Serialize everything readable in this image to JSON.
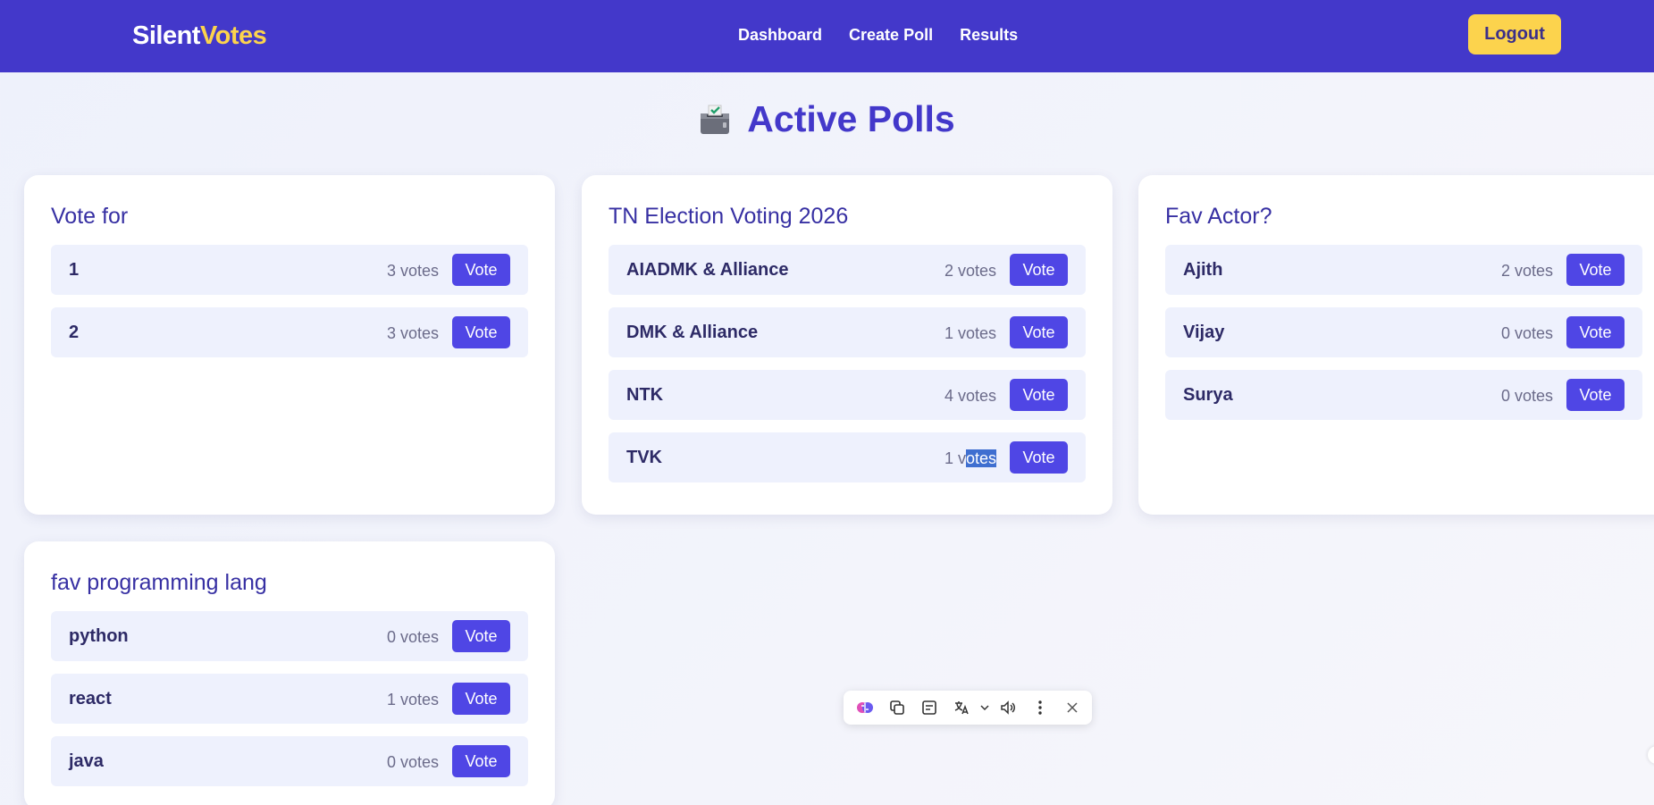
{
  "brand": {
    "part1": "Silent",
    "part2": "Votes"
  },
  "nav": {
    "links": [
      "Dashboard",
      "Create Poll",
      "Results"
    ],
    "logout_label": "Logout"
  },
  "page": {
    "title": "Active Polls",
    "title_icon": "ballot-box-icon"
  },
  "vote_label": "Vote",
  "polls": [
    {
      "title": "Vote for",
      "options": [
        {
          "label": "1",
          "count": "3 votes"
        },
        {
          "label": "2",
          "count": "3 votes"
        }
      ]
    },
    {
      "title": "TN Election Voting 2026",
      "options": [
        {
          "label": "AIADMK & Alliance",
          "count": "2 votes"
        },
        {
          "label": "DMK & Alliance",
          "count": "1 votes"
        },
        {
          "label": "NTK",
          "count": "4 votes"
        },
        {
          "label": "TVK",
          "count": "1 votes"
        }
      ]
    },
    {
      "title": "Fav Actor?",
      "options": [
        {
          "label": "Ajith",
          "count": "2 votes"
        },
        {
          "label": "Vijay",
          "count": "0 votes"
        },
        {
          "label": "Surya",
          "count": "0 votes"
        }
      ]
    },
    {
      "title": "fav programming lang",
      "options": [
        {
          "label": "python",
          "count": "0 votes"
        },
        {
          "label": "react",
          "count": "1 votes"
        },
        {
          "label": "java",
          "count": "0 votes"
        }
      ]
    }
  ],
  "selection": {
    "poll": 1,
    "option": 3,
    "prefix": "1 v",
    "selected": "otes"
  },
  "toolbar": {
    "icons": [
      "ai-assistant-icon",
      "copy-icon",
      "notes-icon",
      "translate-icon",
      "chevron-down-icon",
      "speaker-icon",
      "more-icon",
      "close-icon"
    ]
  },
  "colors": {
    "nav_bg": "#4338ca",
    "accent_yellow": "#fcd34d",
    "button": "#4f46e5",
    "option_bg": "#eef1fd",
    "title": "#4338ca"
  }
}
